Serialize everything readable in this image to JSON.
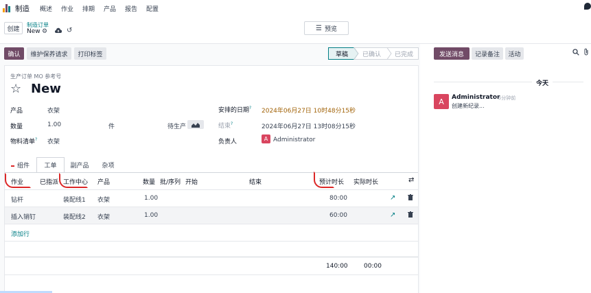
{
  "nav": {
    "app": "制造",
    "menu": [
      "概述",
      "作业",
      "排期",
      "产品",
      "报告",
      "配置"
    ]
  },
  "control": {
    "create_label": "创建",
    "breadcrumb_parent": "制造订单",
    "breadcrumb_current": "New",
    "view_label": "预览"
  },
  "actions": {
    "confirm": "确认",
    "maintenance": "维护保养请求",
    "print_labels": "打印标签"
  },
  "statusbar": [
    "草稿",
    "已确认",
    "已完成"
  ],
  "chatter": {
    "send_message": "发送消息",
    "log_note": "记录备注",
    "activity": "活动",
    "today": "今天",
    "author": "Administrator",
    "time": "- 5分钟前",
    "message": "创建新纪录...",
    "avatar_letter": "A"
  },
  "form": {
    "ref_label": "生产订单 MO 参考号",
    "title": "New",
    "product_label": "产品",
    "product_value": "衣架",
    "qty_label": "数量",
    "qty_value": "1.00",
    "uom_value": "件",
    "to_produce": "待生产",
    "bom_label": "物料清单",
    "bom_value": "衣架",
    "sched_label": "安排的日期",
    "sched_value": "2024年06月27日 10时48分15秒",
    "end_label": "结束",
    "end_value": "2024年06月27日 13时08分15秒",
    "resp_label": "负责人",
    "resp_value": "Administrator",
    "resp_avatar": "A"
  },
  "tabs": [
    "组件",
    "工单",
    "副产品",
    "杂项"
  ],
  "table": {
    "headers": [
      "作业",
      "已指派",
      "工作中心",
      "产品",
      "数量",
      "批/序列",
      "开始",
      "结束",
      "预计时长",
      "实际时长"
    ],
    "rows": [
      {
        "operation": "钻杆",
        "workcenter": "装配线1",
        "product": "衣架",
        "qty": "1.00",
        "expected": "80:00"
      },
      {
        "operation": "插入销钉",
        "workcenter": "装配线2",
        "product": "衣架",
        "qty": "1.00",
        "expected": "60:00"
      }
    ],
    "add_line": "添加行",
    "total_expected": "140:00",
    "total_actual": "00:00"
  },
  "colors": {
    "primary": "#714B67",
    "link": "#017e84",
    "date_highlight": "#a16207",
    "annotation_red": "#dc2626"
  }
}
